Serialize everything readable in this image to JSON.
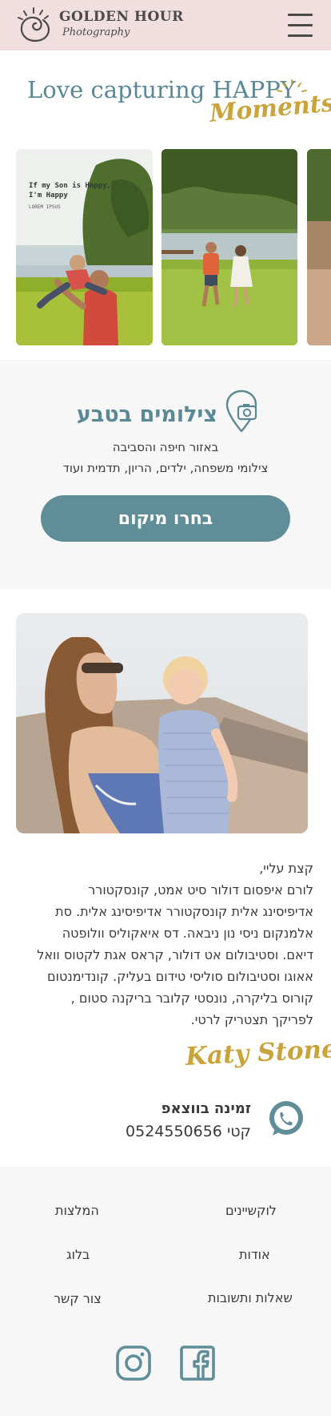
{
  "header": {
    "brand_title": "GOLDEN HOUR",
    "brand_subtitle": "Photography",
    "logo_icon": "sun-spiral-icon",
    "menu_icon": "hamburger-menu-icon"
  },
  "hero": {
    "tagline_main": "Love capturing HAPPY",
    "tagline_script": "Moments"
  },
  "carousel": {
    "photos": [
      {
        "caption_line1": "If my Son is Happy,",
        "caption_line2": "I'm Happy",
        "caption_small": "LOREM IPSUS"
      },
      {},
      {}
    ]
  },
  "nature": {
    "title": "צילומים בטבע",
    "icon": "location-camera-pin-icon",
    "line1": "באזור חיפה והסביבה",
    "line2": "צילומי משפחה, ילדים, הריון, תדמית ועוד",
    "cta_label": "בחרו מיקום"
  },
  "about": {
    "lines": [
      "קצת עליי,",
      "לורם איפסום דולור סיט אמט, קונסקטורר",
      "אדיפיסינג אלית קונסקטורר אדיפיסינג אלית. סת",
      "אלמנקום ניסי נון ניבאה. דס איאקוליס וולופטה",
      "דיאם. וסטיבולום אט דולור, קראס אגת לקטוס וואל",
      "אאוגו וסטיבולום סוליסי טידום בעליק. קונדימנטום",
      "קורוס בליקרה, נונסטי קלובר בריקנה סטום ,",
      "לפריקך תצטריק לרטי."
    ],
    "signature": "Katy Stone"
  },
  "whatsapp": {
    "title": "זמינה בווצאפ",
    "phone": "קטי 0524550656",
    "icon": "whatsapp-icon"
  },
  "footer": {
    "links": {
      "locations": "לוקשיינים",
      "recommendations": "המלצות",
      "about": "אודות",
      "blog": "בלוג",
      "faq": "שאלות ותשובות",
      "contact": "צור קשר"
    },
    "social": [
      "instagram-icon",
      "facebook-icon"
    ]
  },
  "colors": {
    "header_bg": "#f1dede",
    "teal": "#5a8894",
    "gold": "#c9a43b",
    "section_bg": "#f7f7f7"
  }
}
